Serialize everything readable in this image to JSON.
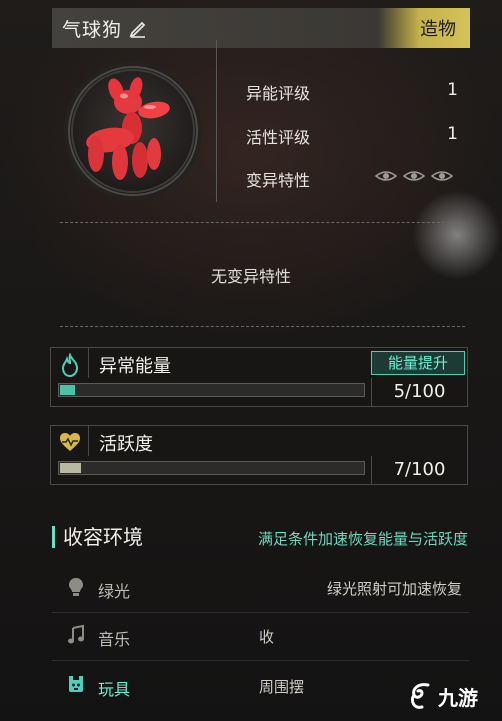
{
  "header": {
    "name": "气球狗",
    "tag": "造物"
  },
  "stats": [
    {
      "label": "异能评级",
      "value": "1"
    },
    {
      "label": "活性评级",
      "value": "1"
    },
    {
      "label": "变异特性",
      "value": ""
    }
  ],
  "mutation_text": "无变异特性",
  "energy": {
    "title": "异常能量",
    "count": "5/100",
    "progress": 0.05,
    "boost_label": "能量提升",
    "fill_color": "#4fbfa5"
  },
  "activity": {
    "title": "活跃度",
    "count": "7/100",
    "progress": 0.07,
    "fill_color": "#b9b9a0"
  },
  "containment": {
    "title": "收容环境",
    "hint": "满足条件加速恢复能量与活跃度",
    "items": [
      {
        "label": "绿光",
        "desc": "绿光照射可加速恢复",
        "icon": "lightbulb-icon"
      },
      {
        "label": "音乐",
        "desc": "收",
        "icon": "music-note-icon"
      },
      {
        "label": "玩具",
        "desc": "周围摆",
        "icon": "toy-icon"
      }
    ]
  },
  "watermark": {
    "text": "九游"
  },
  "colors": {
    "accent": "#6df0d4",
    "tag_gold": "#d4c25a",
    "balloon": "#e8353b"
  }
}
